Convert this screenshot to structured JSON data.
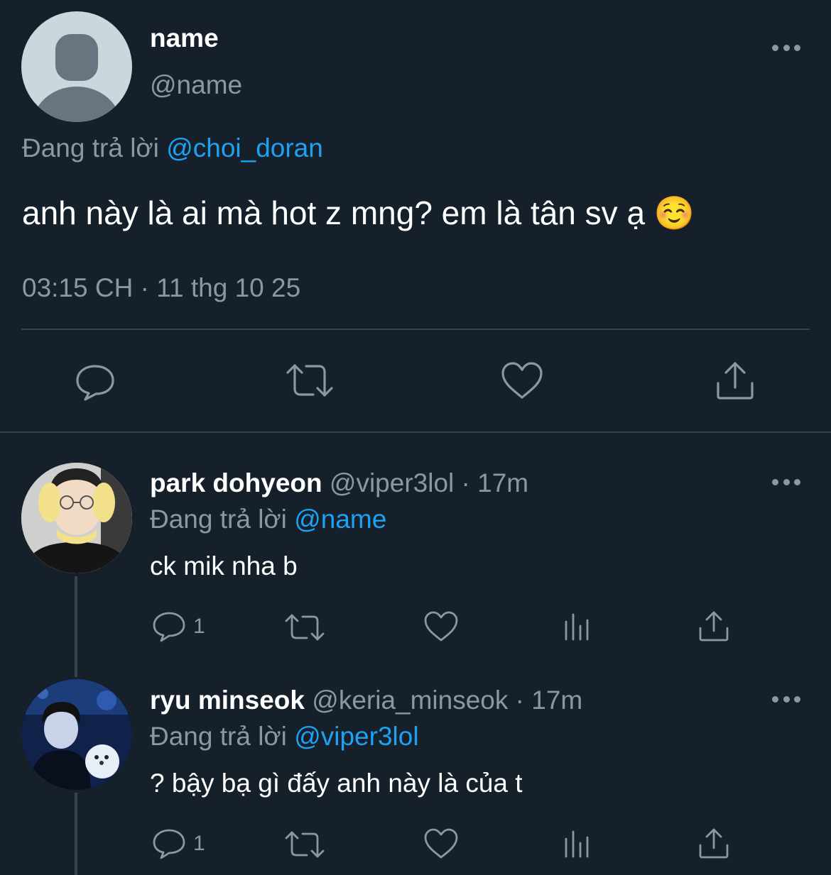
{
  "main_tweet": {
    "name": "name",
    "handle": "@name",
    "replying_prefix": "Đang trả lời",
    "replying_to": "@choi_doran",
    "text": "anh này là ai mà hot z mng? em là tân sv ạ ☺️",
    "timestamp": "03:15 CH · 11 thg 10 25",
    "actions": [
      "reply-icon",
      "retweet-icon",
      "like-icon",
      "share-icon"
    ]
  },
  "replies": [
    {
      "name": "park dohyeon",
      "handle": "@viper3lol",
      "time": "· 17m",
      "replying_prefix": "Đang trả lời",
      "replying_to": "@name",
      "text": "ck mik nha b",
      "reply_count": "1"
    },
    {
      "name": "ryu minseok",
      "handle": "@keria_minseok",
      "time": "· 17m",
      "replying_prefix": "Đang trả lời",
      "replying_to": "@viper3lol",
      "text": "? bậy bạ gì đấy anh này là của t",
      "reply_count": "1"
    }
  ],
  "colors": {
    "background": "#15202b",
    "text": "#ffffff",
    "secondary": "#8899a6",
    "accent": "#1da1f2",
    "divider": "#38444d"
  }
}
